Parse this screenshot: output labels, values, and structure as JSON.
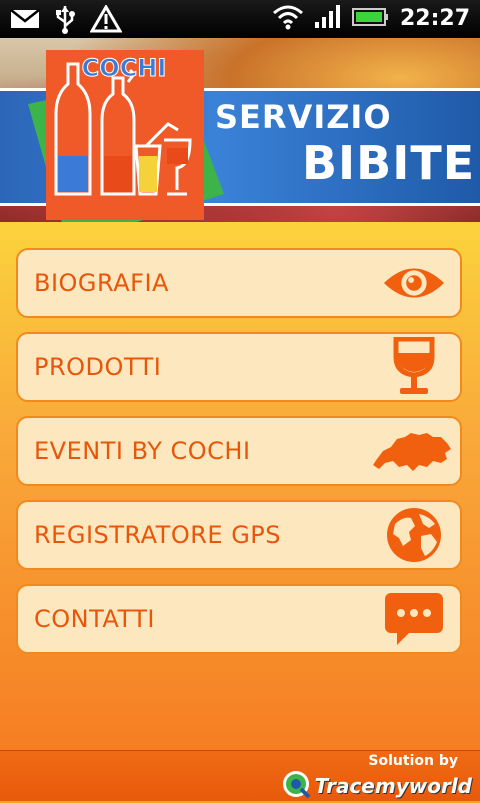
{
  "status_bar": {
    "time": "22:27",
    "icons": [
      "mail-icon",
      "usb-icon",
      "warning-icon",
      "wifi-icon",
      "signal-icon",
      "battery-icon"
    ]
  },
  "header": {
    "logo_text": "COCHI",
    "title_line1": "SERVIZIO",
    "title_line2": "BIBITE"
  },
  "menu": [
    {
      "label": "BIOGRAFIA",
      "icon": "eye-icon"
    },
    {
      "label": "PRODOTTI",
      "icon": "wine-glass-icon"
    },
    {
      "label": "EVENTI BY COCHI",
      "icon": "switzerland-map-icon"
    },
    {
      "label": "REGISTRATORE GPS",
      "icon": "globe-icon"
    },
    {
      "label": "CONTATTI",
      "icon": "chat-bubble-icon"
    }
  ],
  "footer": {
    "credit": "Solution by",
    "brand": "Tracemyworld"
  },
  "colors": {
    "accent_orange": "#e8560a",
    "item_bg": "#fde7bf",
    "banner_blue": "#2c66b8",
    "logo_orange": "#f05a28",
    "logo_green": "#3cb44a"
  }
}
